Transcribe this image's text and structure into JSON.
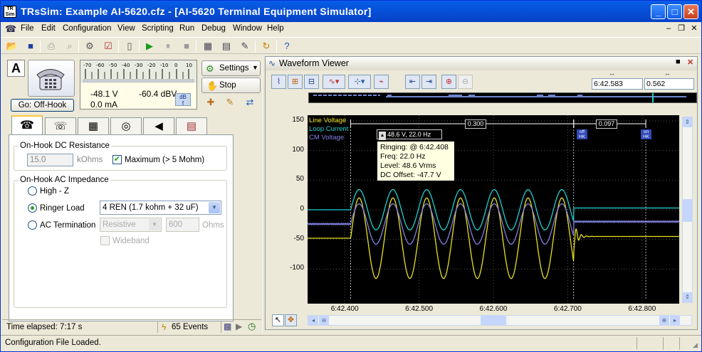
{
  "window": {
    "title": "TRsSim:  Example AI-5620.cfz - [AI-5620  Terminal Equipment Simulator]",
    "app_icon_text": "TR Sim"
  },
  "menu": [
    "File",
    "Edit",
    "Configuration",
    "View",
    "Scripting",
    "Run",
    "Debug",
    "Window",
    "Help"
  ],
  "meter": {
    "scale": [
      "-70",
      "-60",
      "-50",
      "-40",
      "-30",
      "-20",
      "-10",
      "0",
      "10"
    ],
    "voltage": "-48.1  V",
    "current": "0.0 mA",
    "level": "-60.4 dBV",
    "status_letter": "A",
    "hook_button": "Go:  Off-Hook"
  },
  "side_buttons": {
    "settings": "Settings",
    "stop": "Stop"
  },
  "on_hook_dc": {
    "title": "On-Hook DC Resistance",
    "value": "15.0",
    "unit": "kOhms",
    "maximum_label": "Maximum (> 5 Mohm)",
    "maximum_checked": true
  },
  "on_hook_ac": {
    "title": "On-Hook AC Impedance",
    "high_z": "High - Z",
    "ringer_load": "Ringer Load",
    "ringer_value": "4 REN (1.7 kohm + 32 uF)",
    "ac_termination": "AC Termination",
    "ac_type": "Resistive",
    "ac_value": "600",
    "ac_unit": "Ohms",
    "wideband": "Wideband",
    "selected": "ringer_load"
  },
  "status": {
    "time_elapsed": "Time elapsed:  7:17 s",
    "events": "65 Events",
    "message": "Configuration File Loaded."
  },
  "waveform_viewer": {
    "title": "Waveform Viewer",
    "cursor_time": "6:42.583",
    "cursor_delta": "0.562",
    "legend": [
      {
        "name": "Line Voltage",
        "color": "#e8e020"
      },
      {
        "name": "Loop Current",
        "color": "#20d0d0"
      },
      {
        "name": "CM Voltage",
        "color": "#8080e0"
      }
    ],
    "measure_1": "0.300",
    "measure_2": "0.097",
    "marker_value": "48.6 V, 22.0 Hz",
    "event_off": "off HK",
    "event_on": "on HK",
    "tooltip": {
      "line1": "Ringing:  @ 6:42.408",
      "line2": "Freq:  22.0 Hz",
      "line3": "Level:  48.6 Vrms",
      "line4": "DC Offset:  -47.7 V"
    }
  },
  "chart_data": {
    "type": "line",
    "ylim": [
      -150,
      150
    ],
    "xlim": [
      6.4235,
      6.4285
    ],
    "y_ticks": [
      "150",
      "100",
      "50",
      "0",
      "-50",
      "-100"
    ],
    "x_ticks": [
      "6:42.400",
      "6:42.500",
      "6:42.600",
      "6:42.700",
      "6:42.800"
    ],
    "ringing": {
      "start_s": 402.408,
      "stop_s": 402.708,
      "freq_hz": 22.0
    },
    "series": [
      {
        "name": "Line Voltage",
        "color": "#e8e020",
        "idle": -48,
        "ring_center": -48,
        "ring_amplitude": 68
      },
      {
        "name": "Loop Current",
        "color": "#20d0d0",
        "idle": 0,
        "ring_center": 0,
        "ring_amplitude": 34
      },
      {
        "name": "CM Voltage",
        "color": "#8080e0",
        "idle": -24,
        "ring_center": -24,
        "ring_amplitude": 34
      }
    ]
  }
}
